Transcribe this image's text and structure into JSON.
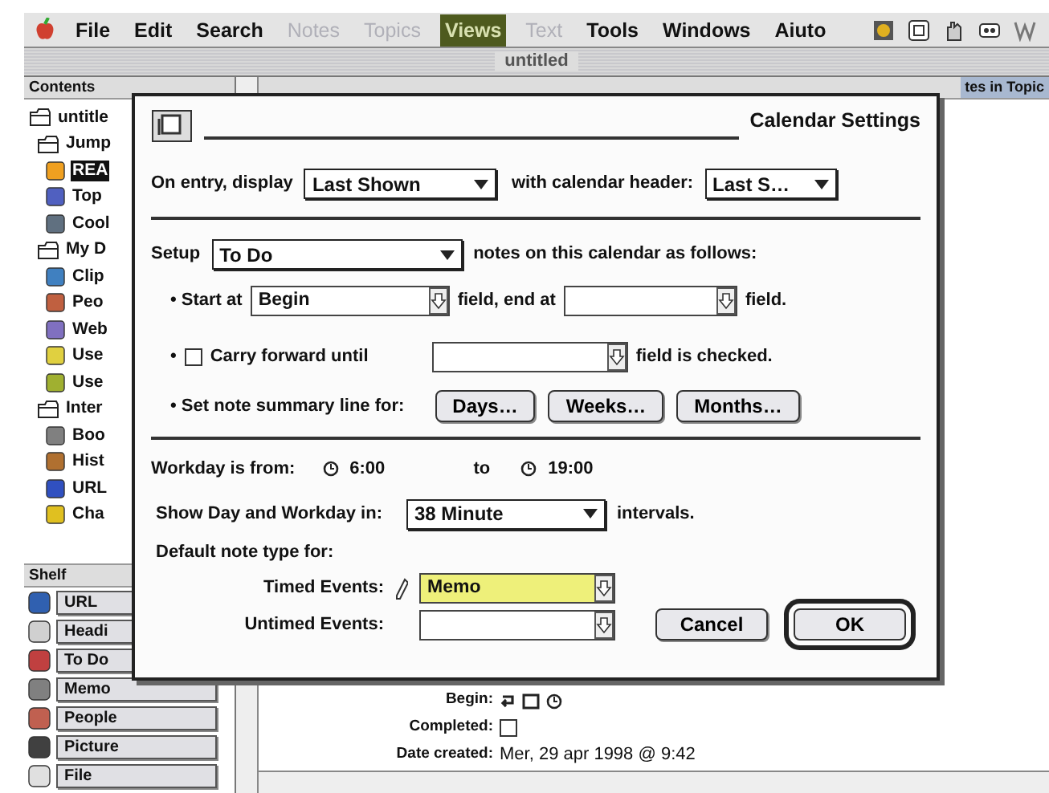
{
  "menu_bar": {
    "items": [
      {
        "label": "File",
        "disabled": false,
        "selected": false
      },
      {
        "label": "Edit",
        "disabled": false,
        "selected": false
      },
      {
        "label": "Search",
        "disabled": false,
        "selected": false
      },
      {
        "label": "Notes",
        "disabled": true,
        "selected": false
      },
      {
        "label": "Topics",
        "disabled": true,
        "selected": false
      },
      {
        "label": "Views",
        "disabled": false,
        "selected": true
      },
      {
        "label": "Text",
        "disabled": true,
        "selected": false
      },
      {
        "label": "Tools",
        "disabled": false,
        "selected": false
      },
      {
        "label": "Windows",
        "disabled": false,
        "selected": false
      },
      {
        "label": "Aiuto",
        "disabled": false,
        "selected": false
      }
    ]
  },
  "window": {
    "title": "untitled"
  },
  "contents": {
    "header": "Contents",
    "tree": [
      {
        "label": "untitle",
        "kind": "folder",
        "selected": false,
        "children": [
          {
            "label": "Jump",
            "kind": "folder",
            "selected": false,
            "children": [
              {
                "label": "REA",
                "kind": "note",
                "selected": true,
                "color": "#f0a020"
              },
              {
                "label": "Top",
                "kind": "note",
                "selected": false,
                "color": "#5060c0"
              },
              {
                "label": "Cool",
                "kind": "note",
                "selected": false,
                "color": "#607080"
              }
            ]
          },
          {
            "label": "My D",
            "kind": "folder",
            "selected": false,
            "children": [
              {
                "label": "Clip",
                "kind": "note",
                "selected": false,
                "color": "#4080c0"
              },
              {
                "label": "Peo",
                "kind": "note",
                "selected": false,
                "color": "#c06040"
              },
              {
                "label": "Web",
                "kind": "note",
                "selected": false,
                "color": "#8070c0"
              },
              {
                "label": "Use",
                "kind": "note",
                "selected": false,
                "color": "#e0d040"
              },
              {
                "label": "Use",
                "kind": "note",
                "selected": false,
                "color": "#a0b030"
              }
            ]
          },
          {
            "label": "Inter",
            "kind": "folder",
            "selected": false,
            "children": [
              {
                "label": "Boo",
                "kind": "note",
                "selected": false,
                "color": "#808080"
              },
              {
                "label": "Hist",
                "kind": "note",
                "selected": false,
                "color": "#b07030"
              },
              {
                "label": "URL",
                "kind": "note",
                "selected": false,
                "color": "#3050c0"
              },
              {
                "label": "Cha",
                "kind": "note",
                "selected": false,
                "color": "#e0c020"
              }
            ]
          }
        ]
      }
    ]
  },
  "shelf": {
    "header": "Shelf",
    "items": [
      {
        "label": "URL",
        "color": "#3060b0"
      },
      {
        "label": "Headi",
        "color": "#d0d0d0"
      },
      {
        "label": "To Do",
        "color": "#c04040"
      },
      {
        "label": "Memo",
        "color": "#808080"
      },
      {
        "label": "People",
        "color": "#c06050"
      },
      {
        "label": "Picture",
        "color": "#404040"
      },
      {
        "label": "File",
        "color": "#e0e0e0"
      }
    ]
  },
  "column_header": "tes in Topic",
  "note_fields": [
    {
      "label": "Begin:",
      "kind": "icons"
    },
    {
      "label": "Completed:",
      "kind": "checkbox",
      "checked": false
    },
    {
      "label": "Date created:",
      "kind": "text",
      "value": "Mer, 29 apr 1998 @ 9:42"
    }
  ],
  "dialog": {
    "title": "Calendar Settings",
    "display": {
      "label": "On entry, display",
      "value": "Last Shown",
      "header_label": "with calendar header:",
      "header_value": "Last S…"
    },
    "setup": {
      "label": "Setup",
      "value": "To Do",
      "suffix": "notes on this calendar as follows:"
    },
    "start": {
      "label": "• Start at",
      "start_value": "Begin",
      "middle": "field, end at",
      "suffix": "field."
    },
    "carry": {
      "bullet": "•",
      "label": "Carry forward until",
      "checked": false,
      "suffix": "field is checked."
    },
    "summary": {
      "label": "• Set note summary line for:",
      "buttons": [
        "Days…",
        "Weeks…",
        "Months…"
      ]
    },
    "workday": {
      "label": "Workday is from:",
      "from": "6:00",
      "to_label": "to",
      "to": "19:00"
    },
    "interval": {
      "label": "Show Day and Workday in:",
      "value": "38 Minute",
      "suffix": "intervals."
    },
    "default_type": {
      "label": "Default note type for:",
      "timed_label": "Timed Events:",
      "timed_value": "Memo",
      "untimed_label": "Untimed Events:"
    },
    "buttons": [
      {
        "label": "Cancel",
        "default": false
      },
      {
        "label": "OK",
        "default": true
      }
    ]
  }
}
